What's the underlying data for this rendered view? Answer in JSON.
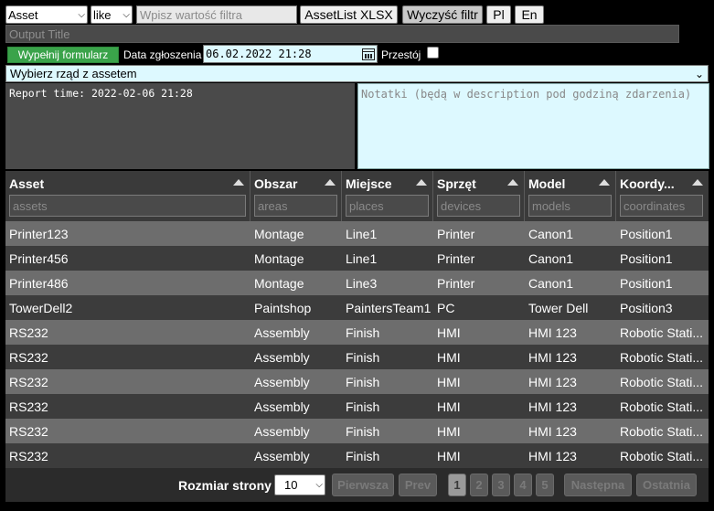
{
  "filter": {
    "field_select": "Asset",
    "operator_select": "like",
    "value_placeholder": "Wpisz wartość filtra",
    "export_button": "AssetList XLSX",
    "clear_button": "Wyczyść filtr",
    "lang_pl": "Pl",
    "lang_en": "En"
  },
  "output_title": "Output Title",
  "form": {
    "fill_button": "Wypełnij formularz",
    "date_label": "Data zgłoszenia",
    "date_value": "06.02.2022  21:28",
    "downtime_label": "Przestój",
    "row_select": "Wybierz rząd z assetem",
    "report_time": "Report time: 2022-02-06 21:28",
    "notes_placeholder": "Notatki (będą w description pod godziną zdarzenia)"
  },
  "table": {
    "columns": [
      {
        "title": "Asset",
        "filter_placeholder": "assets"
      },
      {
        "title": "Obszar",
        "filter_placeholder": "areas"
      },
      {
        "title": "Miejsce",
        "filter_placeholder": "places"
      },
      {
        "title": "Sprzęt",
        "filter_placeholder": "devices"
      },
      {
        "title": "Model",
        "filter_placeholder": "models"
      },
      {
        "title": "Koordy...",
        "filter_placeholder": "coordinates"
      }
    ],
    "rows": [
      [
        "Printer123",
        "Montage",
        "Line1",
        "Printer",
        "Canon1",
        "Position1"
      ],
      [
        "Printer456",
        "Montage",
        "Line1",
        "Printer",
        "Canon1",
        "Position1"
      ],
      [
        "Printer486",
        "Montage",
        "Line3",
        "Printer",
        "Canon1",
        "Position1"
      ],
      [
        "TowerDell2",
        "Paintshop",
        "PaintersTeam1",
        "PC",
        "Tower Dell",
        "Position3"
      ],
      [
        "RS232",
        "Assembly",
        "Finish",
        "HMI",
        "HMI 123",
        "Robotic Stati..."
      ],
      [
        "RS232",
        "Assembly",
        "Finish",
        "HMI",
        "HMI 123",
        "Robotic Stati..."
      ],
      [
        "RS232",
        "Assembly",
        "Finish",
        "HMI",
        "HMI 123",
        "Robotic Stati..."
      ],
      [
        "RS232",
        "Assembly",
        "Finish",
        "HMI",
        "HMI 123",
        "Robotic Stati..."
      ],
      [
        "RS232",
        "Assembly",
        "Finish",
        "HMI",
        "HMI 123",
        "Robotic Stati..."
      ],
      [
        "RS232",
        "Assembly",
        "Finish",
        "HMI",
        "HMI 123",
        "Robotic Stati..."
      ]
    ]
  },
  "pager": {
    "page_size_label": "Rozmiar strony",
    "page_size": "10",
    "first": "Pierwsza",
    "prev": "Prev",
    "pages": [
      "1",
      "2",
      "3",
      "4",
      "5"
    ],
    "active_page": "1",
    "next": "Następna",
    "last": "Ostatnia"
  }
}
